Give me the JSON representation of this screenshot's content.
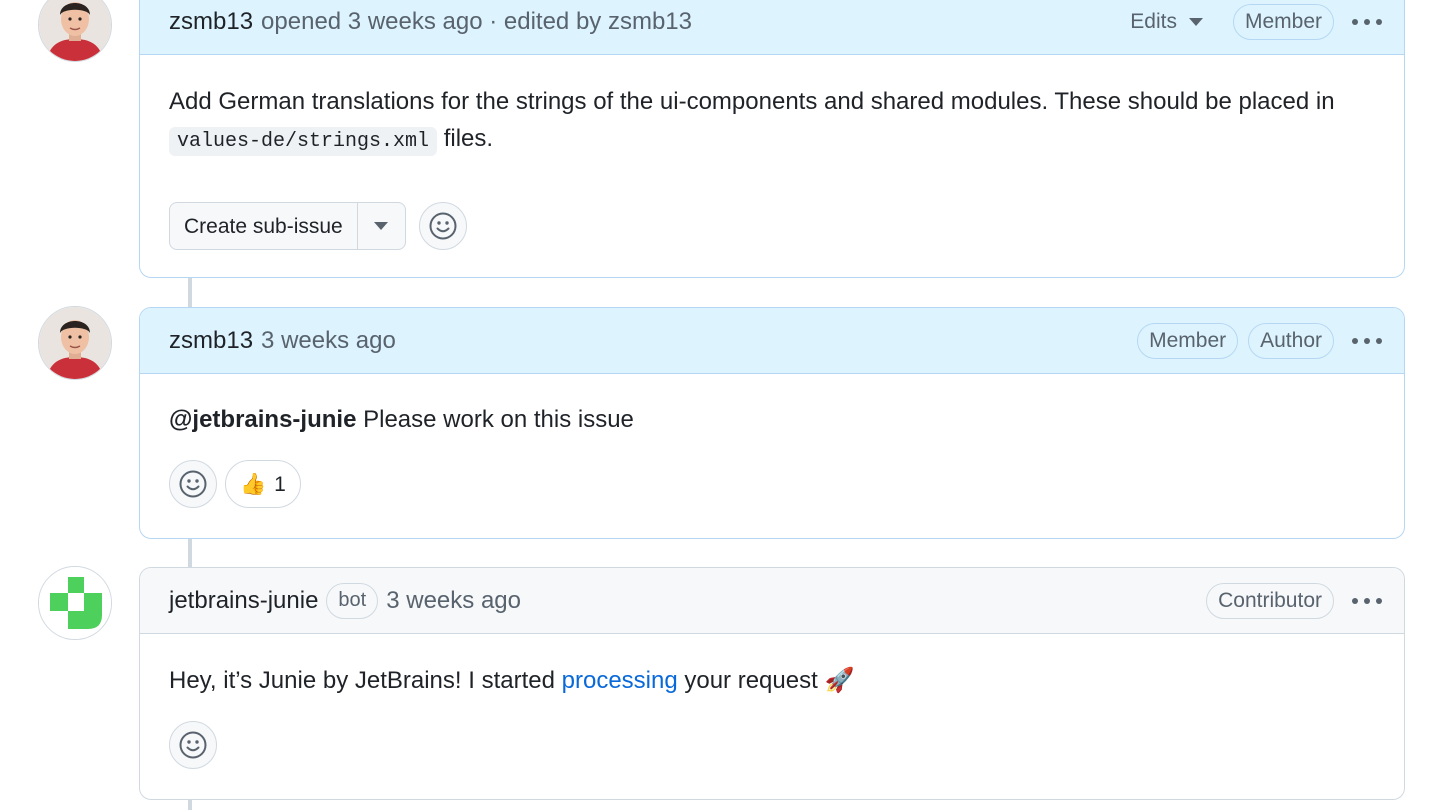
{
  "comments": [
    {
      "author": "zsmb13",
      "meta": "opened 3 weeks ago · edited by zsmb13",
      "edits_label": "Edits",
      "badges": [
        "Member"
      ],
      "body_text_1": "Add German translations for the strings of the ui-components and shared modules. These should be placed in ",
      "body_code": "values-de/strings.xml",
      "body_text_2": " files.",
      "sub_issue_label": "Create sub-issue"
    },
    {
      "author": "zsmb13",
      "meta": "3 weeks ago",
      "badges": [
        "Member",
        "Author"
      ],
      "mention": "@jetbrains-junie",
      "body_text": " Please work on this issue",
      "reaction_emoji": "👍",
      "reaction_count": "1"
    },
    {
      "author": "jetbrains-junie",
      "bot_label": "bot",
      "meta": "3 weeks ago",
      "badges": [
        "Contributor"
      ],
      "body_text_1": "Hey, it’s Junie by JetBrains! I started ",
      "link_text": "processing",
      "body_text_2": " your request ",
      "body_emoji": "🚀"
    }
  ],
  "colors": {
    "header_blue": "#ddf4ff",
    "header_gray": "#f6f8fa",
    "link": "#0969da",
    "junie_green": "#4ed05c"
  }
}
